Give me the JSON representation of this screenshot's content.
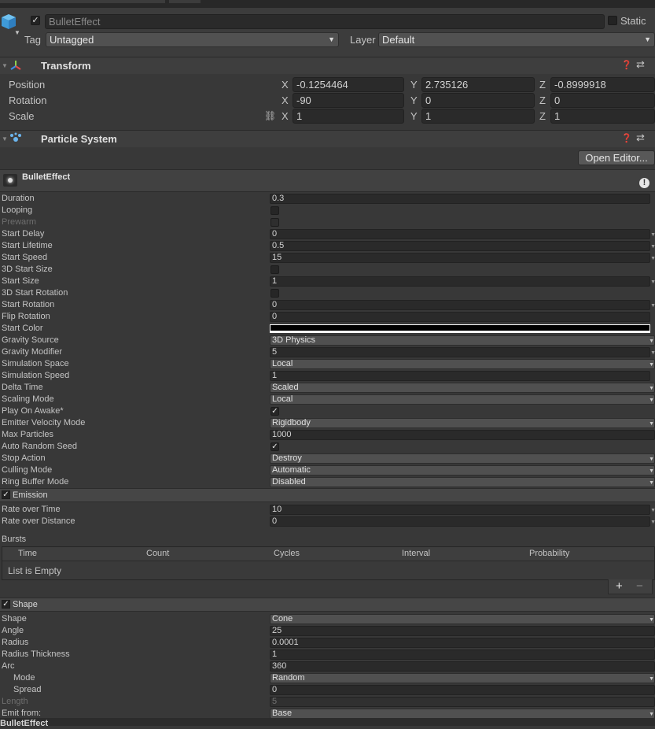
{
  "gameobject": {
    "name": "BulletEffect",
    "active": true,
    "static_label": "Static",
    "tag_label": "Tag",
    "tag_value": "Untagged",
    "layer_label": "Layer",
    "layer_value": "Default"
  },
  "transform": {
    "title": "Transform",
    "rows": [
      {
        "label": "Position",
        "x": "-0.1254464",
        "y": "2.735126",
        "z": "-0.8999918"
      },
      {
        "label": "Rotation",
        "x": "-90",
        "y": "0",
        "z": "0"
      },
      {
        "label": "Scale",
        "x": "1",
        "y": "1",
        "z": "1"
      }
    ],
    "axis": {
      "x": "X",
      "y": "Y",
      "z": "Z"
    }
  },
  "particle_system": {
    "title": "Particle System",
    "open_editor": "Open Editor...",
    "system_name": "BulletEffect",
    "main": {
      "duration": {
        "label": "Duration",
        "value": "0.3"
      },
      "looping": {
        "label": "Looping",
        "checked": false
      },
      "prewarm": {
        "label": "Prewarm",
        "checked": false
      },
      "start_delay": {
        "label": "Start Delay",
        "value": "0"
      },
      "start_lifetime": {
        "label": "Start Lifetime",
        "value": "0.5"
      },
      "start_speed": {
        "label": "Start Speed",
        "value": "15"
      },
      "start_size_3d": {
        "label": "3D Start Size",
        "checked": false
      },
      "start_size": {
        "label": "Start Size",
        "value": "1"
      },
      "start_rotation_3d": {
        "label": "3D Start Rotation",
        "checked": false
      },
      "start_rotation": {
        "label": "Start Rotation",
        "value": "0"
      },
      "flip_rotation": {
        "label": "Flip Rotation",
        "value": "0"
      },
      "start_color": {
        "label": "Start Color",
        "color": "#000000"
      },
      "gravity_source": {
        "label": "Gravity Source",
        "value": "3D Physics"
      },
      "gravity_modifier": {
        "label": "Gravity Modifier",
        "value": "5"
      },
      "simulation_space": {
        "label": "Simulation Space",
        "value": "Local"
      },
      "simulation_speed": {
        "label": "Simulation Speed",
        "value": "1"
      },
      "delta_time": {
        "label": "Delta Time",
        "value": "Scaled"
      },
      "scaling_mode": {
        "label": "Scaling Mode",
        "value": "Local"
      },
      "play_on_awake": {
        "label": "Play On Awake*",
        "checked": true
      },
      "emitter_velocity_mode": {
        "label": "Emitter Velocity Mode",
        "value": "Rigidbody"
      },
      "max_particles": {
        "label": "Max Particles",
        "value": "1000"
      },
      "auto_random_seed": {
        "label": "Auto Random Seed",
        "checked": true
      },
      "stop_action": {
        "label": "Stop Action",
        "value": "Destroy"
      },
      "culling_mode": {
        "label": "Culling Mode",
        "value": "Automatic"
      },
      "ring_buffer_mode": {
        "label": "Ring Buffer Mode",
        "value": "Disabled"
      }
    },
    "emission": {
      "label": "Emission",
      "enabled": true,
      "rate_over_time": {
        "label": "Rate over Time",
        "value": "10"
      },
      "rate_over_distance": {
        "label": "Rate over Distance",
        "value": "0"
      },
      "bursts_label": "Bursts",
      "bursts_columns": [
        "Time",
        "Count",
        "Cycles",
        "Interval",
        "Probability"
      ],
      "bursts_empty": "List is Empty",
      "add": "+",
      "remove": "−"
    },
    "shape": {
      "label": "Shape",
      "enabled": true,
      "shape": {
        "label": "Shape",
        "value": "Cone"
      },
      "angle": {
        "label": "Angle",
        "value": "25"
      },
      "radius": {
        "label": "Radius",
        "value": "0.0001"
      },
      "radius_thickness": {
        "label": "Radius Thickness",
        "value": "1"
      },
      "arc": {
        "label": "Arc",
        "value": "360"
      },
      "mode": {
        "label": "Mode",
        "value": "Random"
      },
      "spread": {
        "label": "Spread",
        "value": "0"
      },
      "length": {
        "label": "Length",
        "value": "5"
      },
      "emit_from": {
        "label": "Emit from:",
        "value": "Base"
      }
    },
    "footer_name": "BulletEffect"
  },
  "colors": {
    "background": "#383838",
    "field": "#2a2a2a",
    "dropdown": "#515151",
    "header": "#3e3e3e"
  }
}
